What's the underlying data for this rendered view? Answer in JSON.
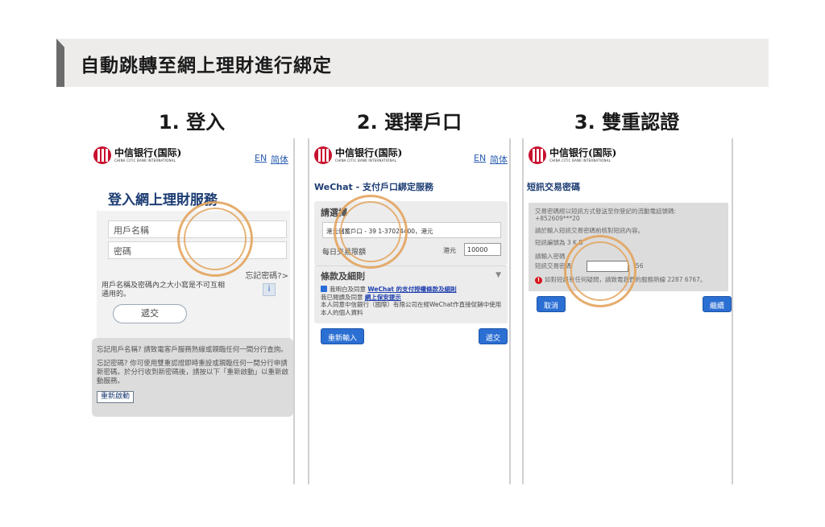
{
  "header": {
    "title": "自動跳轉至網上理財進行綁定"
  },
  "steps": [
    {
      "label": "1. 登入"
    },
    {
      "label": "2. 選擇戶口"
    },
    {
      "label": "3. 雙重認證"
    }
  ],
  "bank": {
    "name_cn": "中信银行(国际)",
    "name_en": "CHINA CITIC BANK INTERNATIONAL"
  },
  "lang": {
    "en": "EN",
    "sc": "简体"
  },
  "login": {
    "title": "登入網上理財服務",
    "username_placeholder": "用戶名稱",
    "password_placeholder": "密碼",
    "forgot": "忘記密碼?>",
    "hint": "用戶名稱及密碼內之大小寫是不可互相通用的。",
    "info": "i",
    "submit": "遞交",
    "help1": "忘記用戶名稱? 請致電客戶服務熱線或親臨任何一間分行查詢。",
    "help2": "忘記密碼? 你可使用雙重認證即時重設或親臨任何一間分行申請新密碼。於分行收到新密碼後，請按以下「重新啟動」以重新啟動服務。",
    "restart": "重新啟動"
  },
  "select": {
    "title": "WeChat - 支付戶口綁定服務",
    "box_head": "請選擇",
    "account": "港元儲蓄戶口 - 39 1-37024400，港元",
    "limit_label": "每日交易限額",
    "currency": "港元",
    "limit_value": "10000",
    "terms_head": "條款及細則",
    "caret": "▼",
    "agree_prefix": "我明白及同意",
    "agree_link": "WeChat 的支付授權條款及細則",
    "read_prefix": "我已閱讀及同意",
    "read_link": "網上保安提示",
    "consent": "本人同意中信銀行（國際）有限公司在經WeChat作直接促銷中使用本人的個人資料",
    "reset": "重新輸入",
    "submit": "遞交"
  },
  "otp": {
    "title": "短訊交易密碼",
    "line1": "交易密碼經以短訊方式發送至你登記的流動電話號碼:",
    "phone": "+852609***20",
    "line2": "請於輸入短訊交易密碼前核對短訊內容。",
    "line3": "短訊編號為 3 K B",
    "line4": "請輸入密碼",
    "input_label": "短訊交易密碼",
    "seconds": "(56",
    "warn": "如對短訊有任何疑問，請致電我們的服務熱線 2287 6767。",
    "cancel": "取消",
    "continue": "繼續"
  }
}
